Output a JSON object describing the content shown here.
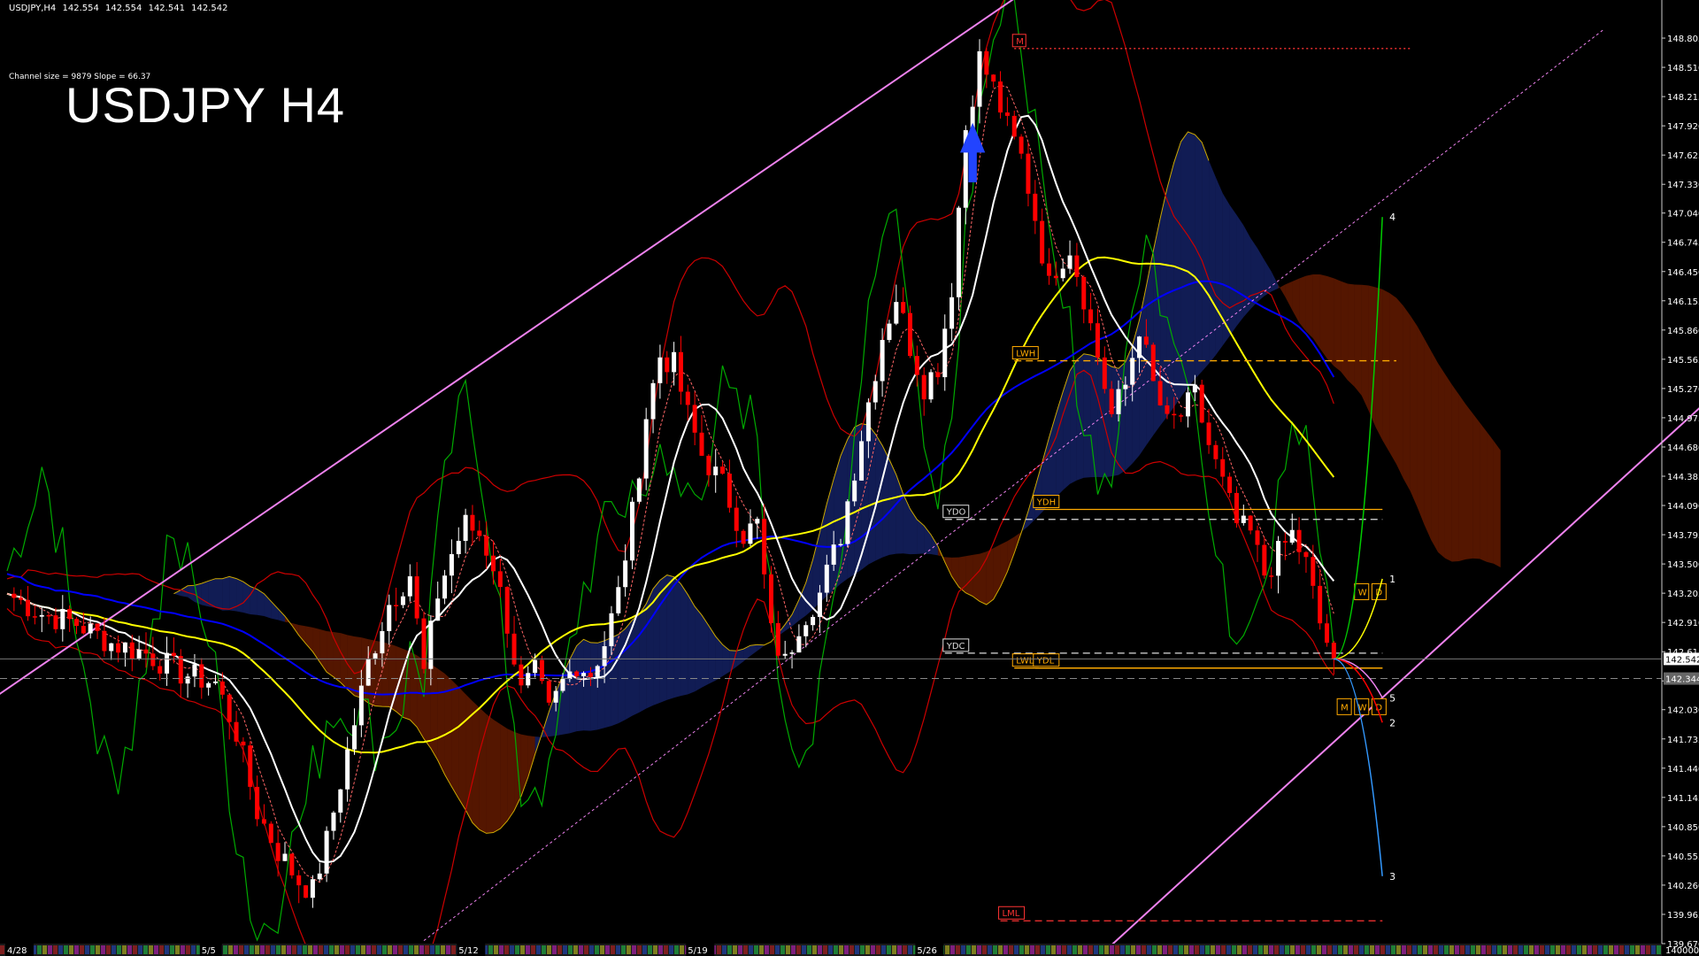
{
  "header": {
    "symbol": "USDJPY,H4",
    "open": "142.554",
    "high": "142.554",
    "low": "142.541",
    "close": "142.542"
  },
  "channel_info": "Channel size = 9879 Slope = 66.37",
  "big_title": "USDJPY H4",
  "colors": {
    "background": "#000000",
    "up_candle": "#ffffff",
    "down_candle": "#ff0000",
    "channel": "#ee82ee",
    "ma_white": "#ffffff",
    "ma_yellow": "#ffff00",
    "ma_blue": "#0000ff",
    "bollinger": "#cc0000",
    "rsi_green": "#00aa00",
    "cloud_red": "#ff4400",
    "cloud_blue": "#3355ff"
  },
  "chart_data": {
    "type": "candlestick",
    "symbol": "USDJPY",
    "timeframe": "H4",
    "ylim": [
      139.67,
      149.1
    ],
    "y_ticks": [
      "148.805",
      "148.510",
      "148.215",
      "147.920",
      "147.625",
      "147.330",
      "147.040",
      "146.745",
      "146.450",
      "146.155",
      "145.860",
      "145.565",
      "145.270",
      "144.975",
      "144.680",
      "144.385",
      "144.090",
      "143.795",
      "143.500",
      "143.205",
      "142.910",
      "142.615",
      "142.320",
      "142.030",
      "141.735",
      "141.440",
      "141.145",
      "140.850",
      "140.555",
      "140.260",
      "139.965",
      "139.670"
    ],
    "x_ticks": [
      {
        "label": "4/28",
        "i": 0
      },
      {
        "label": "5/5",
        "i": 28
      },
      {
        "label": "5/12",
        "i": 65
      },
      {
        "label": "5/19",
        "i": 98
      },
      {
        "label": "5/26",
        "i": 131
      }
    ],
    "bottom_right_label": "140000",
    "current_price": "142.542",
    "secondary_price": "142.344",
    "anchors": [
      [
        0,
        143.2
      ],
      [
        5,
        143.0
      ],
      [
        10,
        142.9
      ],
      [
        15,
        142.7
      ],
      [
        20,
        142.6
      ],
      [
        25,
        142.4
      ],
      [
        30,
        142.3
      ],
      [
        33,
        141.8
      ],
      [
        36,
        141.0
      ],
      [
        39,
        140.6
      ],
      [
        42,
        140.3
      ],
      [
        44,
        140.2
      ],
      [
        46,
        140.7
      ],
      [
        49,
        141.6
      ],
      [
        52,
        142.5
      ],
      [
        55,
        143.1
      ],
      [
        58,
        143.4
      ],
      [
        60,
        142.4
      ],
      [
        62,
        143.2
      ],
      [
        64,
        143.6
      ],
      [
        66,
        143.9
      ],
      [
        68,
        143.8
      ],
      [
        70,
        143.5
      ],
      [
        72,
        142.9
      ],
      [
        74,
        142.2
      ],
      [
        76,
        142.4
      ],
      [
        78,
        142.0
      ],
      [
        80,
        142.3
      ],
      [
        82,
        142.5
      ],
      [
        84,
        142.4
      ],
      [
        86,
        142.7
      ],
      [
        88,
        143.2
      ],
      [
        90,
        144.0
      ],
      [
        92,
        145.0
      ],
      [
        94,
        145.6
      ],
      [
        96,
        145.5
      ],
      [
        98,
        145.0
      ],
      [
        100,
        144.6
      ],
      [
        103,
        144.3
      ],
      [
        106,
        143.8
      ],
      [
        108,
        143.9
      ],
      [
        110,
        142.8
      ],
      [
        112,
        142.5
      ],
      [
        114,
        142.9
      ],
      [
        117,
        143.2
      ],
      [
        120,
        143.8
      ],
      [
        123,
        144.8
      ],
      [
        126,
        145.8
      ],
      [
        128,
        146.2
      ],
      [
        130,
        145.7
      ],
      [
        132,
        145.3
      ],
      [
        134,
        145.5
      ],
      [
        136,
        146.3
      ],
      [
        138,
        147.9
      ],
      [
        140,
        148.6
      ],
      [
        142,
        148.3
      ],
      [
        144,
        147.9
      ],
      [
        146,
        147.6
      ],
      [
        148,
        147.0
      ],
      [
        150,
        146.3
      ],
      [
        151,
        146.5
      ],
      [
        153,
        146.7
      ],
      [
        155,
        146.2
      ],
      [
        157,
        145.6
      ],
      [
        159,
        145.0
      ],
      [
        161,
        145.3
      ],
      [
        163,
        145.9
      ],
      [
        165,
        145.3
      ],
      [
        167,
        144.9
      ],
      [
        169,
        145.0
      ],
      [
        171,
        145.2
      ],
      [
        173,
        144.7
      ],
      [
        175,
        144.3
      ],
      [
        177,
        143.9
      ],
      [
        179,
        143.8
      ],
      [
        181,
        143.4
      ],
      [
        183,
        143.6
      ],
      [
        185,
        143.8
      ],
      [
        187,
        143.5
      ],
      [
        189,
        142.9
      ],
      [
        191,
        142.542
      ]
    ],
    "channel_upper": {
      "x0": -5,
      "y0": 142.0,
      "x1": 147,
      "y1": 149.3
    },
    "channel_lower": {
      "x0": 155,
      "y0": 139.4,
      "x1": 255,
      "y1": 145.8
    },
    "channel_mid_dashed": {
      "x0": 60,
      "y0": 139.7,
      "x1": 230,
      "y1": 148.9
    },
    "level_lines": [
      {
        "label": "M",
        "price": 148.7,
        "x0": 145,
        "x1": 202,
        "color": "#ff3333",
        "style": "dotted"
      },
      {
        "label": "LWH",
        "price": 145.55,
        "x0": 145,
        "x1": 200,
        "color": "#ffaa00",
        "style": "dashed"
      },
      {
        "label": "YDO",
        "price": 143.95,
        "x0": 135,
        "x1": 198,
        "color": "#dddddd",
        "style": "dashed"
      },
      {
        "label": "YDH",
        "price": 144.05,
        "x0": 148,
        "x1": 198,
        "color": "#ffaa00",
        "style": "solid"
      },
      {
        "label": "YDC",
        "price": 142.6,
        "x0": 135,
        "x1": 198,
        "color": "#dddddd",
        "style": "dashed"
      },
      {
        "label": "LWL",
        "price": 142.45,
        "x0": 145,
        "x1": 198,
        "color": "#ffaa00",
        "style": "solid"
      },
      {
        "label": "YDL",
        "price": 142.45,
        "x0": 148,
        "x1": 198,
        "color": "#ffaa00",
        "style": "solid"
      },
      {
        "label": "LML",
        "price": 139.9,
        "x0": 143,
        "x1": 198,
        "color": "#ff3333",
        "style": "dashed"
      }
    ],
    "box_labels": [
      {
        "text": "W",
        "price": 143.22,
        "i": 195
      },
      {
        "text": "D",
        "price": 143.22,
        "i": 197.5
      },
      {
        "text": "M",
        "price": 142.06,
        "i": 192.5
      },
      {
        "text": "W",
        "price": 142.06,
        "i": 195
      },
      {
        "text": "D",
        "price": 142.06,
        "i": 197.5
      }
    ],
    "projections": [
      {
        "label": "4",
        "price": 147.0,
        "color": "#00cc00"
      },
      {
        "label": "1",
        "price": 143.35,
        "color": "#ffff00"
      },
      {
        "label": "5",
        "price": 142.15,
        "color": "#ee82ee"
      },
      {
        "label": "2",
        "price": 141.9,
        "color": "#ff0000"
      },
      {
        "label": "3",
        "price": 140.35,
        "color": "#3399ff"
      }
    ]
  }
}
